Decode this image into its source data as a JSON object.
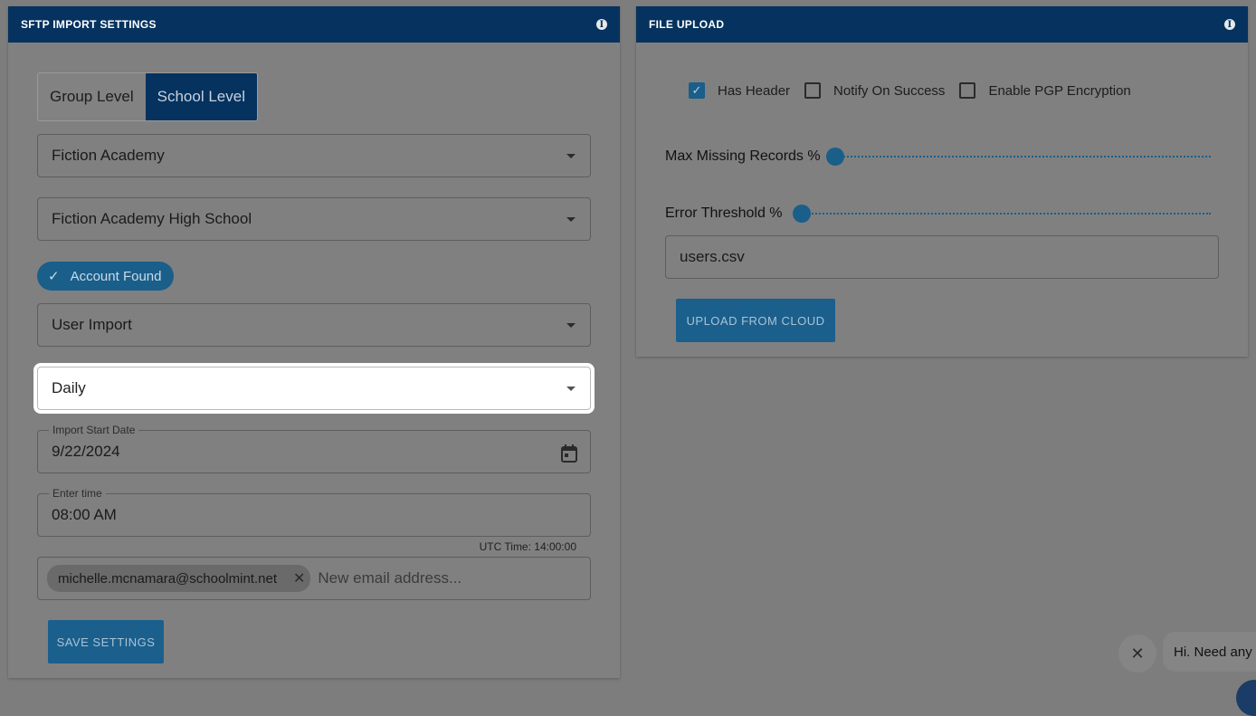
{
  "sftp_panel": {
    "title": "SFTP IMPORT SETTINGS",
    "toggle": {
      "group_label": "Group Level",
      "school_label": "School Level",
      "selected": "School Level"
    },
    "group_select": {
      "value": "Fiction Academy"
    },
    "school_select": {
      "value": "Fiction Academy High School"
    },
    "account_badge": {
      "label": "Account Found"
    },
    "import_type_select": {
      "value": "User Import"
    },
    "frequency_select": {
      "value": "Daily"
    },
    "start_date": {
      "label": "Import Start Date",
      "value": "9/22/2024"
    },
    "time": {
      "label": "Enter time",
      "value": "08:00 AM",
      "utc_note": "UTC Time: 14:00:00"
    },
    "emails": {
      "chips": [
        "michelle.mcnamara@schoolmint.net"
      ],
      "placeholder": "New email address..."
    },
    "save_button": "SAVE SETTINGS"
  },
  "upload_panel": {
    "title": "FILE UPLOAD",
    "checkboxes": [
      {
        "label": "Has Header",
        "checked": true
      },
      {
        "label": "Notify On Success",
        "checked": false
      },
      {
        "label": "Enable PGP Encryption",
        "checked": false
      }
    ],
    "sliders": [
      {
        "label": "Max Missing Records %",
        "value": 0
      },
      {
        "label": "Error Threshold %",
        "value": 0
      }
    ],
    "file_name": "users.csv",
    "upload_button": "UPLOAD FROM CLOUD"
  },
  "chat": {
    "message": "Hi. Need any h"
  },
  "colors": {
    "header": "#05325e",
    "accent": "#1a5e8a",
    "overlay": "#808080"
  }
}
